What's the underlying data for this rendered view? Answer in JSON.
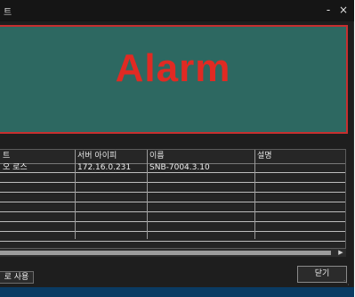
{
  "window": {
    "title": "트",
    "minimize_label": "-",
    "close_label": "×"
  },
  "alarm": {
    "text": "Alarm",
    "bg_color": "#2d6861",
    "border_color": "#c62f2f",
    "text_color": "#e02a23"
  },
  "table": {
    "columns": [
      "트",
      "서버 아이피",
      "이름",
      "설명"
    ],
    "rows": [
      [
        "오 로스",
        "172.16.0.231",
        "SNB-7004.3.10",
        ""
      ]
    ]
  },
  "footer": {
    "left_button_label": "로 사용",
    "close_button_label": "닫기"
  },
  "icons": {
    "scroll_right": "chevron-right-icon",
    "resize": "resize-grip-icon"
  }
}
